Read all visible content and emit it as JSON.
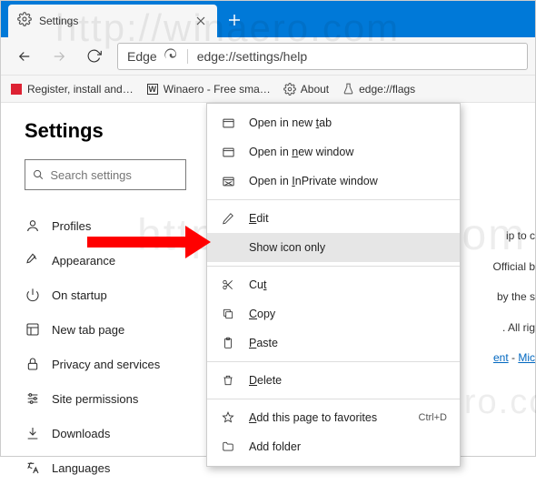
{
  "tab": {
    "title": "Settings"
  },
  "address": {
    "brand": "Edge",
    "url": "edge://settings/help"
  },
  "bookmarks": [
    {
      "label": "Register, install and…"
    },
    {
      "label": "Winaero - Free sma…"
    },
    {
      "label": "About"
    },
    {
      "label": "edge://flags"
    }
  ],
  "sidebar": {
    "title": "Settings",
    "search_placeholder": "Search settings",
    "items": [
      {
        "label": "Profiles"
      },
      {
        "label": "Appearance"
      },
      {
        "label": "On startup"
      },
      {
        "label": "New tab page"
      },
      {
        "label": "Privacy and services"
      },
      {
        "label": "Site permissions"
      },
      {
        "label": "Downloads"
      },
      {
        "label": "Languages"
      }
    ]
  },
  "context_menu": {
    "open_tab_pre": "Open in new ",
    "open_tab_u": "t",
    "open_tab_post": "ab",
    "open_win_pre": "Open in ",
    "open_win_u": "n",
    "open_win_post": "ew window",
    "open_inp_pre": "Open in ",
    "open_inp_u": "I",
    "open_inp_post": "nPrivate window",
    "edit_u": "E",
    "edit_post": "dit",
    "show_icon": "Show icon only",
    "cut_pre": "Cu",
    "cut_u": "t",
    "copy_u": "C",
    "copy_post": "opy",
    "paste_u": "P",
    "paste_post": "aste",
    "delete_u": "D",
    "delete_post": "elete",
    "addfav_u": "A",
    "addfav_post": "dd this page to favorites",
    "addfav_short": "Ctrl+D",
    "addfolder": "Add folder"
  },
  "right_text": {
    "l1": "ip to c",
    "l2": "Official b",
    "l3": "by the s",
    "l4": ". All rig",
    "l5a": "ent",
    "l5b": " - ",
    "l5c": "Mic"
  },
  "watermark": "http://winaero.com"
}
